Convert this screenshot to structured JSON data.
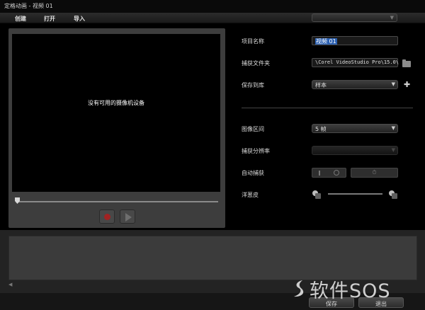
{
  "window": {
    "title": "定格动画 - 视频 01"
  },
  "menu": {
    "create": "创建",
    "open": "打开",
    "import": "导入"
  },
  "top_dropdown": {
    "value": ""
  },
  "preview": {
    "no_device_message": "没有可用的摄像机设备",
    "progress": 0
  },
  "settings": {
    "project_name_label": "项目名称",
    "project_name_value": "视频 01",
    "capture_folder_label": "捕获文件夹",
    "capture_folder_value": "\\Corel VideoStudio Pro\\15.0\\",
    "save_to_library_label": "保存到库",
    "save_to_library_value": "样本",
    "image_duration_label": "图像区间",
    "image_duration_value": "5 帧",
    "capture_resolution_label": "捕获分辨率",
    "capture_resolution_value": "",
    "auto_capture_label": "自动捕获",
    "auto_capture_button": "⏱",
    "onion_skin_label": "洋葱皮"
  },
  "footer": {
    "save": "保存",
    "exit": "退出"
  },
  "watermark": {
    "text": "软件SOS"
  }
}
